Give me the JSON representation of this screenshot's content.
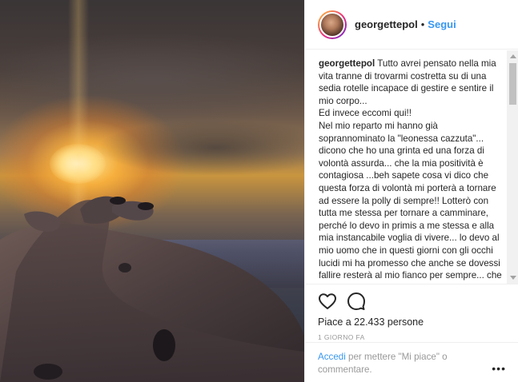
{
  "post": {
    "username": "georgettepol",
    "separator": "•",
    "follow_label": "Segui",
    "caption_user": "georgettepol",
    "caption_text": " Tutto avrei pensato nella mia vita tranne di trovarmi costretta su di una sedia rotelle incapace di gestire e sentire il mio corpo...\nEd invece eccomi qui!!\nNel mio reparto mi hanno già soprannominato la \"leonessa cazzuta\"... dicono che ho una grinta ed una forza di volontà assurda... che la mia positività è contagiosa ...beh sapete cosa vi dico che questa forza di volontà mi porterà a tornare ad essere la polly di sempre!! Lotterò con tutta me stessa per tornare a camminare, perché lo devo in primis a me stessa e alla mia instancabile voglia di vivere... lo devo al mio uomo che in questi giorni con gli occhi lucidi mi ha promesso che anche se dovessi fallire resterà al mio fianco per sempre... che mi ha detto di essersi innamorato una seconda volta perché nonostante tutto non",
    "likes_label": "Piace a 22.433 persone",
    "time_label": "1 GIORNO FA",
    "comment_login": "Accedi",
    "comment_prompt": " per mettere \"Mi piace\" o commentare.",
    "more_label": "•••"
  },
  "icons": {
    "like": "heart-icon",
    "comment": "comment-bubble-icon"
  },
  "colors": {
    "link_blue": "#3897f0",
    "text": "#262626",
    "muted": "#999999",
    "border": "#efefef"
  }
}
